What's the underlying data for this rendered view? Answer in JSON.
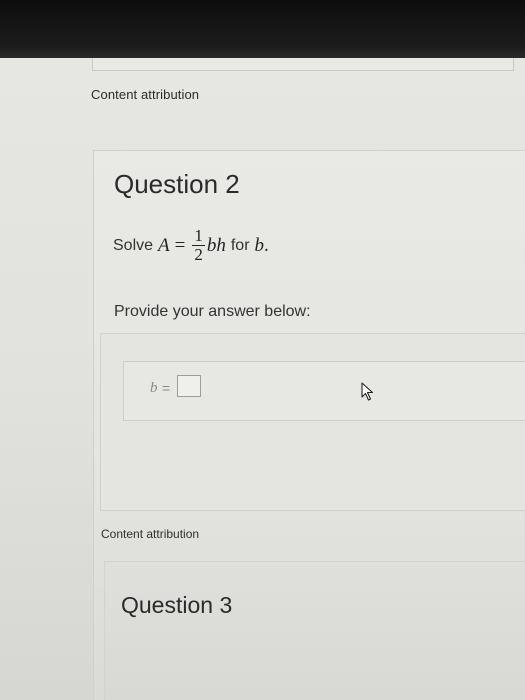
{
  "content_attribution_top": "Content attribution",
  "question": {
    "title": "Question 2",
    "prompt": {
      "solve_word": "Solve",
      "lhs_var": "A",
      "equals": "=",
      "frac_num": "1",
      "frac_den": "2",
      "rhs_vars": "bh",
      "for_word": "for",
      "target_var": "b",
      "period": "."
    },
    "provide_text": "Provide your answer below:",
    "answer": {
      "label_var": "b",
      "equals": "=",
      "value": ""
    }
  },
  "content_attribution_bottom": "Content attribution",
  "next_question": {
    "title": "Question 3"
  },
  "icons": {
    "cursor": "mouse-pointer-icon"
  }
}
